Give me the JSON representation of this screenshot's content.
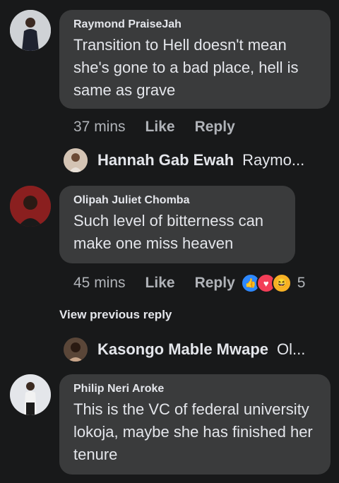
{
  "comments": [
    {
      "author": "Raymond PraiseJah",
      "text": "Transition to Hell doesn't mean she's gone to a bad place, hell is same as grave",
      "time": "37 mins",
      "like": "Like",
      "reply": "Reply"
    },
    {
      "author": "Olipah Juliet Chomba",
      "text": "Such level of bitterness can make one miss heaven",
      "time": "45 mins",
      "like": "Like",
      "reply": "Reply",
      "reaction_count": "5"
    },
    {
      "author": "Philip Neri Aroke",
      "text": "This is the VC of federal university lokoja, maybe she has finished her tenure"
    }
  ],
  "replies": [
    {
      "author": "Hannah Gab Ewah",
      "preview": "Raymo..."
    },
    {
      "author": "Kasongo Mable Mwape",
      "preview": "Ol..."
    }
  ],
  "view_previous": "View previous reply",
  "reactions": [
    "like-icon",
    "love-icon",
    "haha-icon"
  ],
  "colors": {
    "background": "#18191a",
    "bubble": "#3a3b3c",
    "like": "#2d88ff",
    "love": "#f33e58",
    "haha": "#f7b125"
  }
}
